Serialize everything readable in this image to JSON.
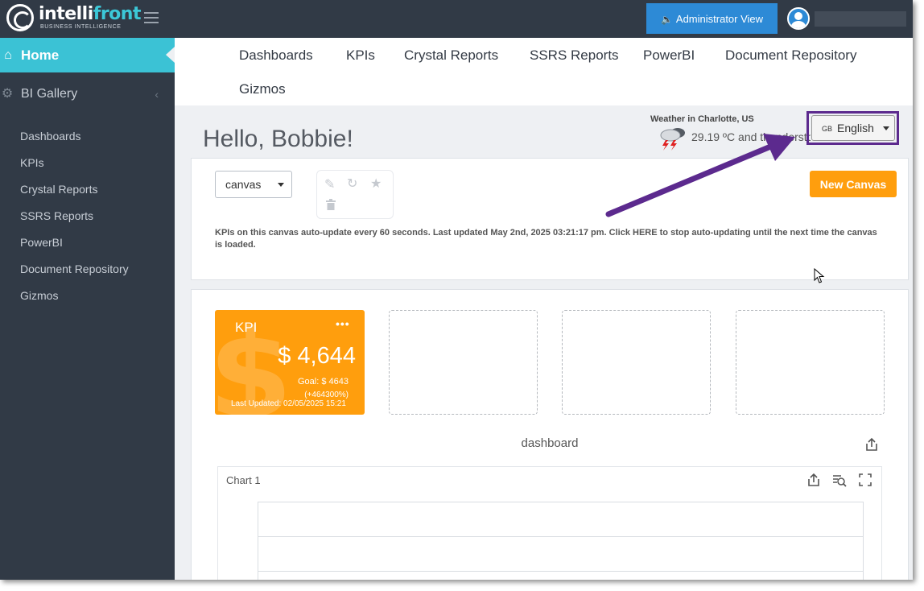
{
  "brand": {
    "name_part1": "intelli",
    "name_part2": "front",
    "tagline": "BUSINESS INTELLIGENCE"
  },
  "topbar": {
    "admin_label": "Administrator View",
    "admin_icon": "megaphone-icon",
    "user_icon": "user-avatar-icon"
  },
  "sidebar": {
    "home_label": "Home",
    "home_icon": "home-icon",
    "gallery_label": "BI Gallery",
    "gallery_icon": "gear-icon",
    "items": [
      {
        "label": "Dashboards"
      },
      {
        "label": "KPIs"
      },
      {
        "label": "Crystal Reports"
      },
      {
        "label": "SSRS Reports"
      },
      {
        "label": "PowerBI"
      },
      {
        "label": "Document Repository"
      },
      {
        "label": "Gizmos"
      }
    ]
  },
  "topnav": {
    "items": [
      {
        "label": "Dashboards"
      },
      {
        "label": "KPIs"
      },
      {
        "label": "Crystal Reports"
      },
      {
        "label": "SSRS Reports"
      },
      {
        "label": "PowerBI"
      },
      {
        "label": "Document Repository"
      },
      {
        "label": "Gizmos"
      }
    ]
  },
  "greeting": "Hello, Bobbie!",
  "weather": {
    "title": "Weather in Charlotte, US",
    "text": "29.19 ºC and thunderstorm",
    "icon": "thunderstorm-icon"
  },
  "language": {
    "flag": "GB",
    "label": "English"
  },
  "canvas": {
    "selected": "canvas",
    "new_label": "New Canvas",
    "tools": [
      "pencil-icon",
      "refresh-icon",
      "star-icon",
      "trash-icon"
    ],
    "update_note": "KPIs on this canvas auto-update every 60 seconds. Last updated May 2nd, 2025 03:21:17 pm. Click HERE to stop auto-updating until the next time the canvas is loaded."
  },
  "kpi": {
    "title": "KPI",
    "menu": "•••",
    "value": "$ 4,644",
    "goal": "Goal: $ 4643",
    "percent": "(+464300%)",
    "updated": "Last Updated: 02/05/2025 15:21"
  },
  "dashboard": {
    "title": "dashboard"
  },
  "chart": {
    "title": "Chart 1"
  },
  "colors": {
    "topbar": "#313a46",
    "sidebar": "#313a46",
    "home_active": "#3bc2d5",
    "admin_button": "#2d8ad6",
    "kpi_orange": "#ff9e0d",
    "new_canvas": "#ff9e0d",
    "annotation": "#5c2a8e"
  }
}
